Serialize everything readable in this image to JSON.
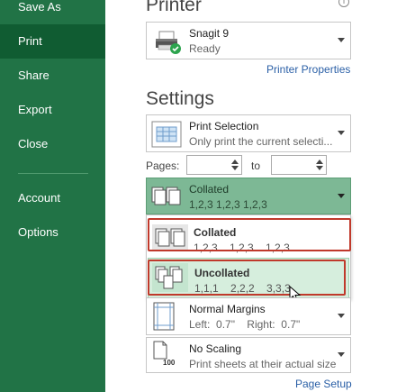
{
  "sidebar": {
    "items": [
      {
        "label": "Save As"
      },
      {
        "label": "Print"
      },
      {
        "label": "Share"
      },
      {
        "label": "Export"
      },
      {
        "label": "Close"
      },
      {
        "label": "Account"
      },
      {
        "label": "Options"
      }
    ],
    "selected": "Print",
    "background": "#217346",
    "selected_background": "#105c32"
  },
  "printer": {
    "heading": "Printer",
    "name": "Snagit 9",
    "status": "Ready",
    "properties_link": "Printer Properties"
  },
  "settings": {
    "heading": "Settings",
    "print_what": {
      "title": "Print Selection",
      "subtitle": "Only print the current selecti..."
    },
    "pages": {
      "label": "Pages:",
      "to_label": "to",
      "from_value": "",
      "to_value": ""
    },
    "collation": {
      "title": "Collated",
      "subtitle": "1,2,3    1,2,3    1,2,3",
      "options": [
        {
          "title": "Collated",
          "values": "1,2,3    1,2,3    1,2,3"
        },
        {
          "title": "Uncollated",
          "values": "1,1,1    2,2,2    3,3,3"
        }
      ],
      "hovered": "Uncollated"
    },
    "margins": {
      "title": "Normal Margins",
      "subtitle": "Left:  0.7\"    Right:  0.7\""
    },
    "scaling": {
      "title": "No Scaling",
      "subtitle": "Print sheets at their actual size",
      "icon_number": "100"
    },
    "page_setup_link": "Page Setup"
  },
  "colors": {
    "accent_green": "#217346",
    "selected_green": "#7db895",
    "hover_green": "#d6eedd",
    "highlight_red": "#c0392b",
    "link_blue": "#2a5fa6"
  },
  "icons": [
    "printer-icon",
    "ready-check-icon",
    "info-icon",
    "selection-sheet-icon",
    "collated-icon",
    "uncollated-icon",
    "margins-icon",
    "scaling-page-icon",
    "mouse-cursor-icon"
  ]
}
